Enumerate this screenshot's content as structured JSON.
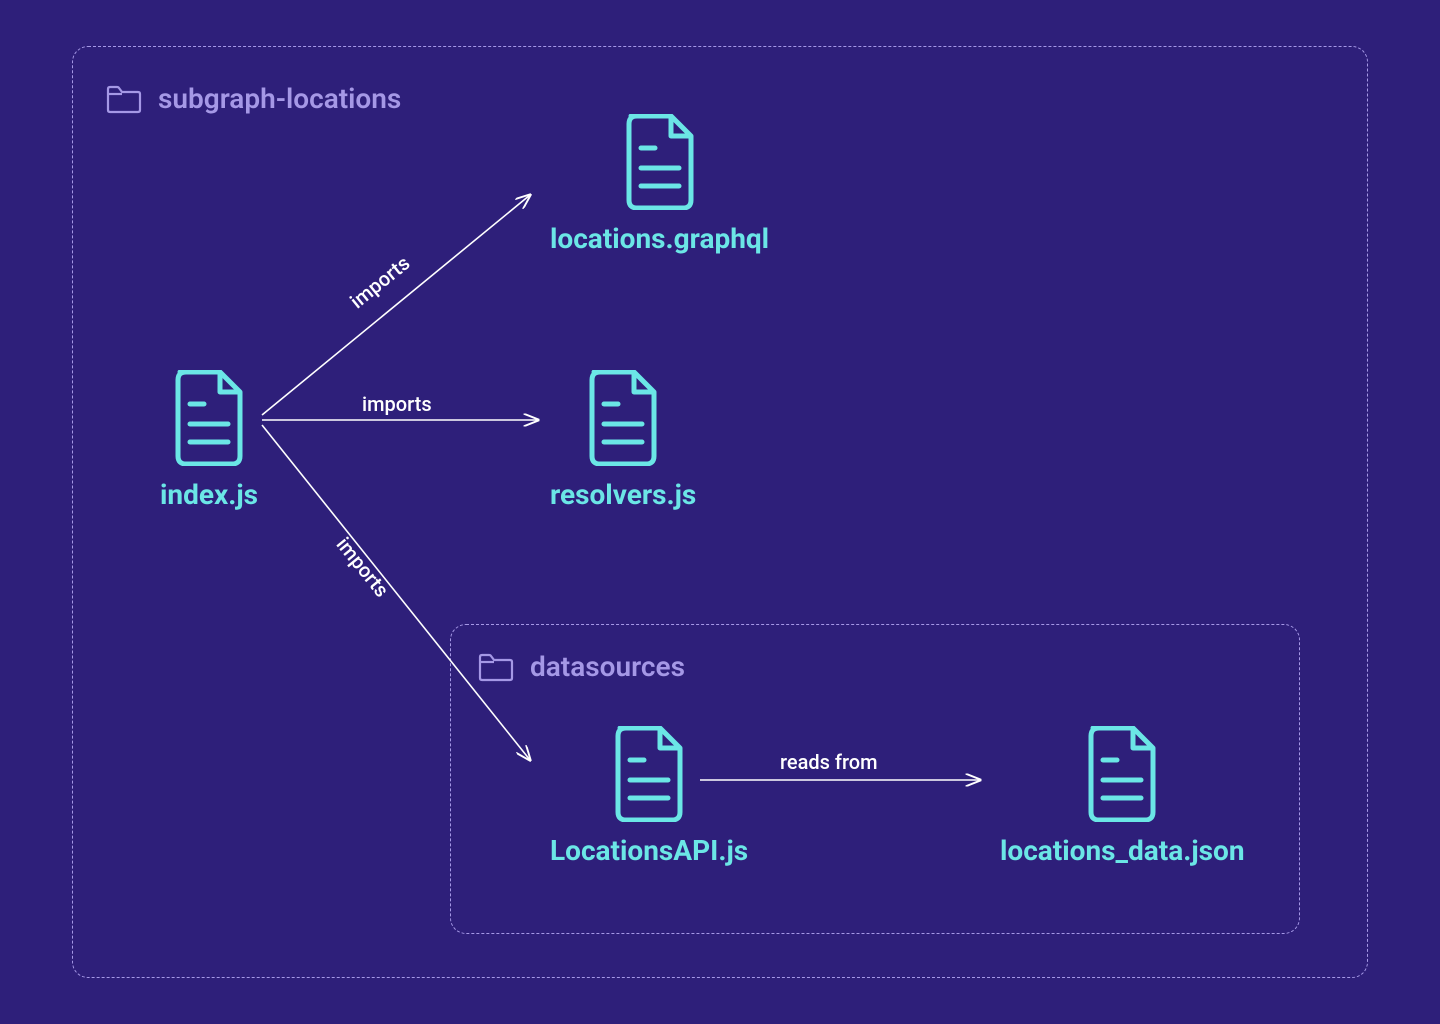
{
  "outerFolder": {
    "label": "subgraph-locations"
  },
  "innerFolder": {
    "label": "datasources"
  },
  "files": {
    "index": "index.js",
    "schema": "locations.graphql",
    "resolvers": "resolvers.js",
    "api": "LocationsAPI.js",
    "dataFile": "locations_data.json"
  },
  "edges": {
    "imports1": "imports",
    "imports2": "imports",
    "imports3": "imports",
    "readsFrom": "reads from"
  },
  "colors": {
    "bg": "#2e1f7a",
    "accent": "#6be6e6",
    "muted": "#a598e6",
    "arrow": "#ffffff"
  }
}
